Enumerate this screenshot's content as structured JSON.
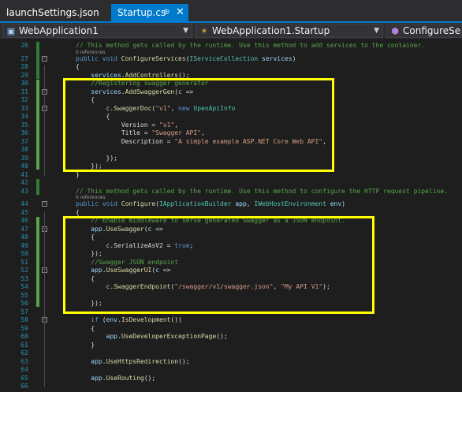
{
  "tabs": [
    {
      "label": "launchSettings.json"
    },
    {
      "label": "Startup.cs",
      "pin": "⊕",
      "close": "✕"
    }
  ],
  "nav": {
    "project": "WebApplication1",
    "class": "WebApplication1.Startup",
    "member": "ConfigureServic"
  },
  "colors": {
    "keyword": "#569cd6",
    "type": "#4ec9b0",
    "string": "#d69d85",
    "comment": "#57a64a",
    "method": "#dcdcaa",
    "highlight": "#ffff00",
    "accent": "#007acc"
  },
  "references": [
    "0 references",
    "0 references"
  ],
  "code": [
    {
      "n": "26",
      "indent": 0,
      "parts": [
        [
          "c",
          "// This method gets called by the runtime. Use this method to add services to the container."
        ]
      ]
    },
    {
      "n": "27",
      "indent": 0,
      "parts": [
        [
          "k",
          "public void "
        ],
        [
          "m",
          "ConfigureServices"
        ],
        [
          "t",
          "("
        ],
        [
          "y",
          "IServiceCollection"
        ],
        [
          "v",
          " services"
        ],
        [
          "t",
          ")"
        ]
      ]
    },
    {
      "n": "28",
      "indent": 0,
      "parts": [
        [
          "t",
          "{"
        ]
      ]
    },
    {
      "n": "29",
      "indent": 2,
      "parts": [
        [
          "v",
          "services"
        ],
        [
          "t",
          "."
        ],
        [
          "m",
          "AddControllers"
        ],
        [
          "t",
          "();"
        ]
      ]
    },
    {
      "n": "30",
      "indent": 2,
      "parts": [
        [
          "c",
          "//Registering swagger generator"
        ]
      ]
    },
    {
      "n": "31",
      "indent": 2,
      "parts": [
        [
          "v",
          "services"
        ],
        [
          "t",
          "."
        ],
        [
          "m",
          "AddSwaggerGen"
        ],
        [
          "t",
          "("
        ],
        [
          "v",
          "c"
        ],
        [
          "t",
          " =>"
        ]
      ]
    },
    {
      "n": "32",
      "indent": 2,
      "parts": [
        [
          "t",
          "{"
        ]
      ]
    },
    {
      "n": "33",
      "indent": 4,
      "parts": [
        [
          "v",
          "c"
        ],
        [
          "t",
          "."
        ],
        [
          "m",
          "SwaggerDoc"
        ],
        [
          "t",
          "("
        ],
        [
          "s",
          "\"v1\""
        ],
        [
          "t",
          ", "
        ],
        [
          "k",
          "new "
        ],
        [
          "y",
          "OpenApiInfo"
        ]
      ]
    },
    {
      "n": "34",
      "indent": 4,
      "parts": [
        [
          "t",
          "{"
        ]
      ]
    },
    {
      "n": "35",
      "indent": 6,
      "parts": [
        [
          "t",
          "Version = "
        ],
        [
          "s",
          "\"v1\""
        ],
        [
          "t",
          ","
        ]
      ]
    },
    {
      "n": "36",
      "indent": 6,
      "parts": [
        [
          "t",
          "Title = "
        ],
        [
          "s",
          "\"Swagger API\""
        ],
        [
          "t",
          ","
        ]
      ]
    },
    {
      "n": "37",
      "indent": 6,
      "parts": [
        [
          "t",
          "Description = "
        ],
        [
          "s",
          "\"A simple example ASP.NET Core Web API\""
        ],
        [
          "t",
          ","
        ]
      ]
    },
    {
      "n": "38",
      "indent": 0,
      "parts": []
    },
    {
      "n": "39",
      "indent": 4,
      "parts": [
        [
          "t",
          "});"
        ]
      ]
    },
    {
      "n": "40",
      "indent": 2,
      "parts": [
        [
          "t",
          "});"
        ]
      ]
    },
    {
      "n": "41",
      "indent": 0,
      "parts": [
        [
          "t",
          "}"
        ]
      ]
    },
    {
      "n": "42",
      "indent": 0,
      "parts": []
    },
    {
      "n": "43",
      "indent": 0,
      "parts": [
        [
          "c",
          "// This method gets called by the runtime. Use this method to configure the HTTP request pipeline."
        ]
      ]
    },
    {
      "n": "44",
      "indent": 0,
      "parts": [
        [
          "k",
          "public void "
        ],
        [
          "m",
          "Configure"
        ],
        [
          "t",
          "("
        ],
        [
          "y",
          "IApplicationBuilder"
        ],
        [
          "v",
          " app"
        ],
        [
          "t",
          ", "
        ],
        [
          "y",
          "IWebHostEnvironment"
        ],
        [
          "v",
          " env"
        ],
        [
          "t",
          ")"
        ]
      ]
    },
    {
      "n": "45",
      "indent": 0,
      "parts": [
        [
          "t",
          "{"
        ]
      ]
    },
    {
      "n": "46",
      "indent": 2,
      "parts": [
        [
          "c",
          "// Enable middleware to serve generated Swagger as a JSON endpoint."
        ]
      ]
    },
    {
      "n": "47",
      "indent": 2,
      "parts": [
        [
          "v",
          "app"
        ],
        [
          "t",
          "."
        ],
        [
          "m",
          "UseSwagger"
        ],
        [
          "t",
          "("
        ],
        [
          "v",
          "c"
        ],
        [
          "t",
          " =>"
        ]
      ]
    },
    {
      "n": "48",
      "indent": 2,
      "parts": [
        [
          "t",
          "{"
        ]
      ]
    },
    {
      "n": "49",
      "indent": 4,
      "parts": [
        [
          "v",
          "c"
        ],
        [
          "t",
          ".SerializeAsV2 = "
        ],
        [
          "k",
          "true"
        ],
        [
          "t",
          ";"
        ]
      ]
    },
    {
      "n": "50",
      "indent": 2,
      "parts": [
        [
          "t",
          "});"
        ]
      ]
    },
    {
      "n": "51",
      "indent": 2,
      "parts": [
        [
          "c",
          "//Swagger JSON endpoint"
        ]
      ]
    },
    {
      "n": "52",
      "indent": 2,
      "parts": [
        [
          "v",
          "app"
        ],
        [
          "t",
          "."
        ],
        [
          "m",
          "UseSwaggerUI"
        ],
        [
          "t",
          "("
        ],
        [
          "v",
          "c"
        ],
        [
          "t",
          " =>"
        ]
      ]
    },
    {
      "n": "53",
      "indent": 2,
      "parts": [
        [
          "t",
          "{"
        ]
      ]
    },
    {
      "n": "54",
      "indent": 4,
      "parts": [
        [
          "v",
          "c"
        ],
        [
          "t",
          "."
        ],
        [
          "m",
          "SwaggerEndpoint"
        ],
        [
          "t",
          "("
        ],
        [
          "s",
          "\"/swagger/v1/swagger.json\""
        ],
        [
          "t",
          ", "
        ],
        [
          "s",
          "\"My API V1\""
        ],
        [
          "t",
          ");"
        ]
      ]
    },
    {
      "n": "55",
      "indent": 0,
      "parts": []
    },
    {
      "n": "56",
      "indent": 2,
      "parts": [
        [
          "t",
          "});"
        ]
      ]
    },
    {
      "n": "57",
      "indent": 0,
      "parts": []
    },
    {
      "n": "58",
      "indent": 2,
      "parts": [
        [
          "k",
          "if "
        ],
        [
          "t",
          "("
        ],
        [
          "v",
          "env"
        ],
        [
          "t",
          "."
        ],
        [
          "m",
          "IsDevelopment"
        ],
        [
          "t",
          "())"
        ]
      ]
    },
    {
      "n": "59",
      "indent": 2,
      "parts": [
        [
          "t",
          "{"
        ]
      ]
    },
    {
      "n": "60",
      "indent": 4,
      "parts": [
        [
          "v",
          "app"
        ],
        [
          "t",
          "."
        ],
        [
          "m",
          "UseDeveloperExceptionPage"
        ],
        [
          "t",
          "();"
        ]
      ]
    },
    {
      "n": "61",
      "indent": 2,
      "parts": [
        [
          "t",
          "}"
        ]
      ]
    },
    {
      "n": "62",
      "indent": 0,
      "parts": []
    },
    {
      "n": "63",
      "indent": 2,
      "parts": [
        [
          "v",
          "app"
        ],
        [
          "t",
          "."
        ],
        [
          "m",
          "UseHttpsRedirection"
        ],
        [
          "t",
          "();"
        ]
      ]
    },
    {
      "n": "64",
      "indent": 0,
      "parts": []
    },
    {
      "n": "65",
      "indent": 2,
      "parts": [
        [
          "v",
          "app"
        ],
        [
          "t",
          "."
        ],
        [
          "m",
          "UseRouting"
        ],
        [
          "t",
          "();"
        ]
      ]
    },
    {
      "n": "66",
      "indent": 0,
      "parts": []
    }
  ]
}
